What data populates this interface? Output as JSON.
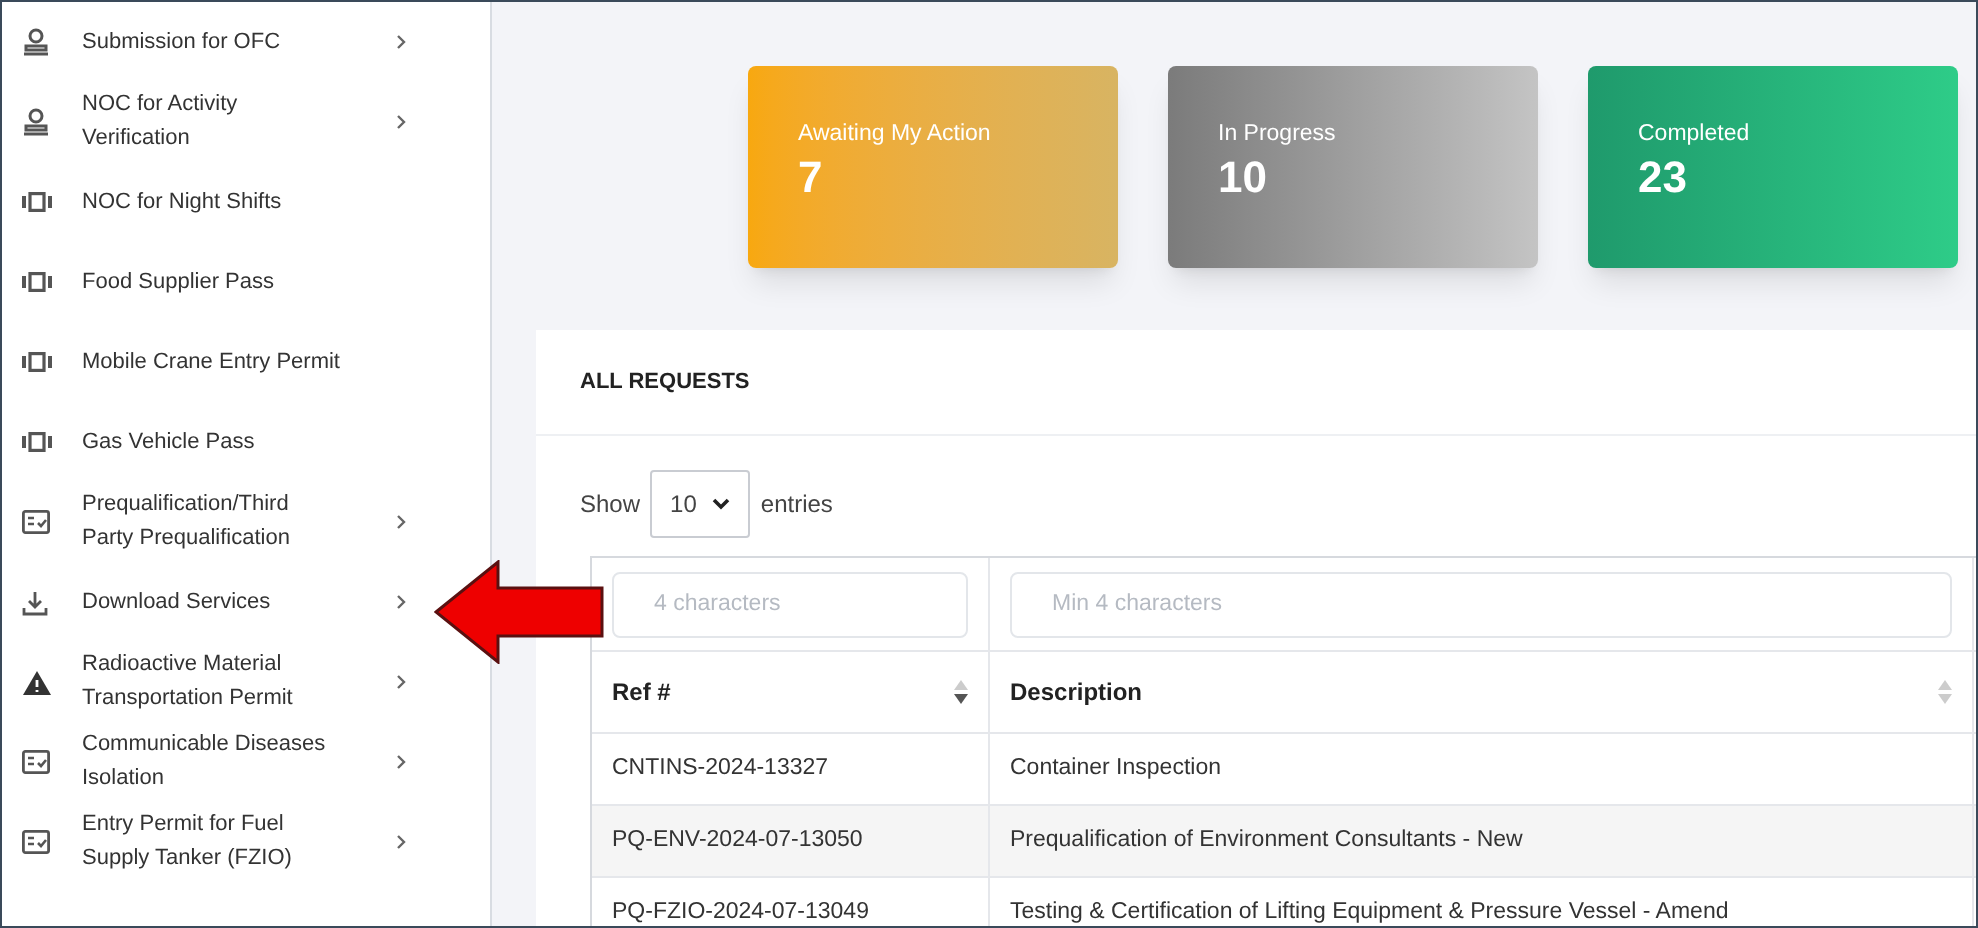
{
  "sidebar": {
    "items": [
      {
        "label": "Submission for OFC",
        "kind": "stamp",
        "has_submenu": true
      },
      {
        "label": "NOC for Activity Verification",
        "kind": "stamp",
        "has_submenu": true
      },
      {
        "label": "NOC for Night Shifts",
        "kind": "device",
        "has_submenu": false
      },
      {
        "label": "Food Supplier Pass",
        "kind": "device",
        "has_submenu": false
      },
      {
        "label": "Mobile Crane Entry Permit",
        "kind": "device",
        "has_submenu": false
      },
      {
        "label": "Gas Vehicle Pass",
        "kind": "device",
        "has_submenu": false
      },
      {
        "label": "Prequalification/Third Party Prequalification",
        "kind": "card",
        "has_submenu": true
      },
      {
        "label": "Download Services",
        "kind": "download",
        "has_submenu": true
      },
      {
        "label": "Radioactive Material Transportation Permit",
        "kind": "warning",
        "has_submenu": true
      },
      {
        "label": "Communicable Diseases Isolation",
        "kind": "card",
        "has_submenu": true
      },
      {
        "label": "Entry Permit for Fuel Supply Tanker (FZIO)",
        "kind": "card",
        "has_submenu": true
      }
    ]
  },
  "summary_cards": [
    {
      "label": "Awaiting My Action",
      "count": "7",
      "kind": "awaiting"
    },
    {
      "label": "In Progress",
      "count": "10",
      "kind": "progress"
    },
    {
      "label": "Completed",
      "count": "23",
      "kind": "completed"
    }
  ],
  "requests": {
    "title": "ALL REQUESTS",
    "show_label": "Show",
    "page_size": "10",
    "entries_label": "entries",
    "filters": [
      {
        "placeholder": "4 characters"
      },
      {
        "placeholder": "Min 4 characters"
      }
    ],
    "columns": [
      {
        "label": "Ref #",
        "sorted": true
      },
      {
        "label": "Description",
        "sorted": false
      }
    ],
    "rows": [
      {
        "cells": [
          "CNTINS-2024-13327",
          "Container Inspection"
        ]
      },
      {
        "cells": [
          "PQ-ENV-2024-07-13050",
          "Prequalification of Environment Consultants - New"
        ]
      },
      {
        "cells": [
          "PQ-FZIO-2024-07-13049",
          "Testing & Certification of Lifting Equipment & Pressure Vessel - Amend"
        ]
      }
    ]
  },
  "annotation": {
    "kind": "arrow"
  }
}
